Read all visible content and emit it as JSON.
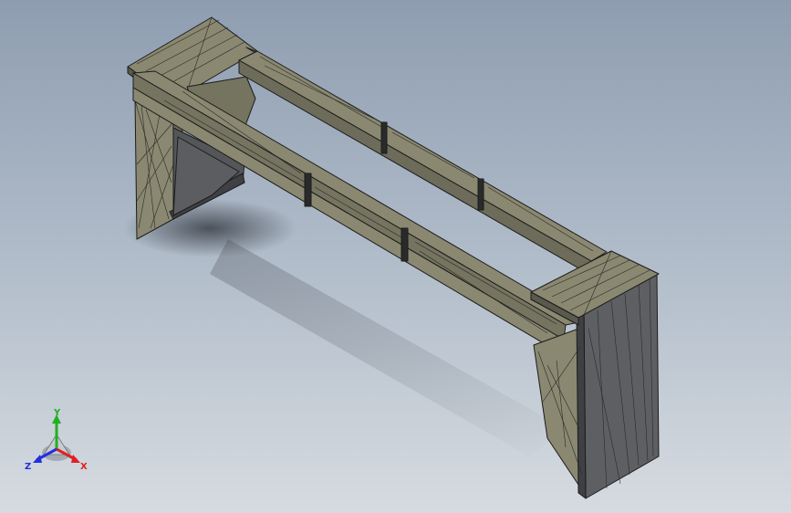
{
  "viewport": {
    "background_top": "#8e9db0",
    "background_bottom": "#d6dbe0"
  },
  "model": {
    "part_name": "",
    "surface_color": "#8a8870",
    "shaded_color": "#5e5f63",
    "edge_color": "#1c1c1c"
  },
  "triad": {
    "x_label": "X",
    "y_label": "Y",
    "z_label": "Z",
    "x_color": "#e02020",
    "y_color": "#20b020",
    "z_color": "#2030e0"
  }
}
